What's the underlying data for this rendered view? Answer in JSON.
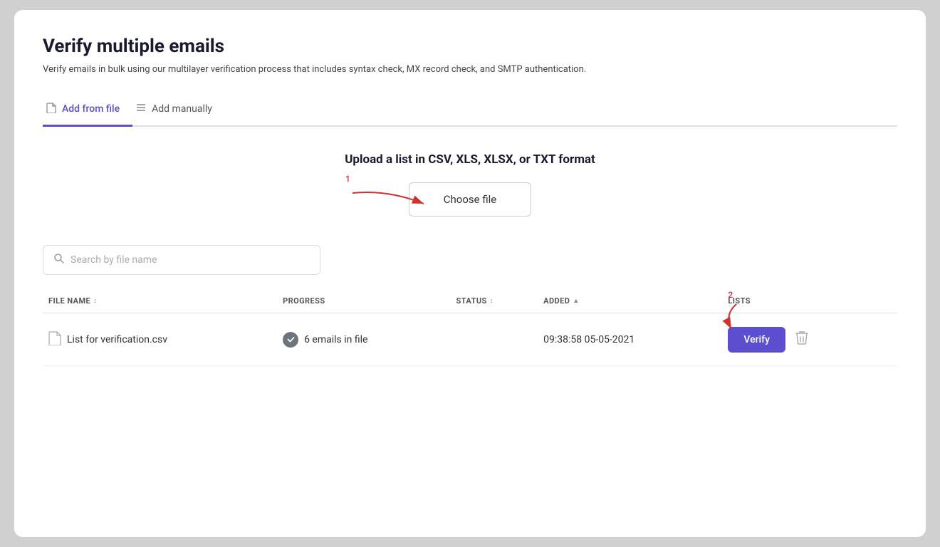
{
  "page": {
    "title": "Verify multiple emails",
    "subtitle": "Verify emails in bulk using our multilayer verification process that includes syntax check, MX record check, and SMTP authentication."
  },
  "tabs": [
    {
      "id": "add-from-file",
      "label": "Add from file",
      "icon": "📄",
      "active": true
    },
    {
      "id": "add-manually",
      "label": "Add manually",
      "icon": "≡",
      "active": false
    }
  ],
  "upload": {
    "title": "Upload a list in CSV, XLS, XLSX, or TXT format",
    "chooseFileLabel": "Choose file"
  },
  "search": {
    "placeholder": "Search by file name"
  },
  "table": {
    "columns": [
      {
        "id": "file-name",
        "label": "FILE NAME",
        "sortable": true
      },
      {
        "id": "progress",
        "label": "PROGRESS",
        "sortable": false
      },
      {
        "id": "status",
        "label": "STATUS",
        "sortable": true
      },
      {
        "id": "added",
        "label": "ADDED",
        "sortable": true
      },
      {
        "id": "lists",
        "label": "LISTS",
        "sortable": false
      }
    ],
    "rows": [
      {
        "fileName": "List for verification.csv",
        "progress": "6 emails in file",
        "status": "",
        "added": "09:38:58 05-05-2021",
        "verifyLabel": "Verify"
      }
    ]
  },
  "annotations": {
    "one": "1",
    "two": "2"
  }
}
